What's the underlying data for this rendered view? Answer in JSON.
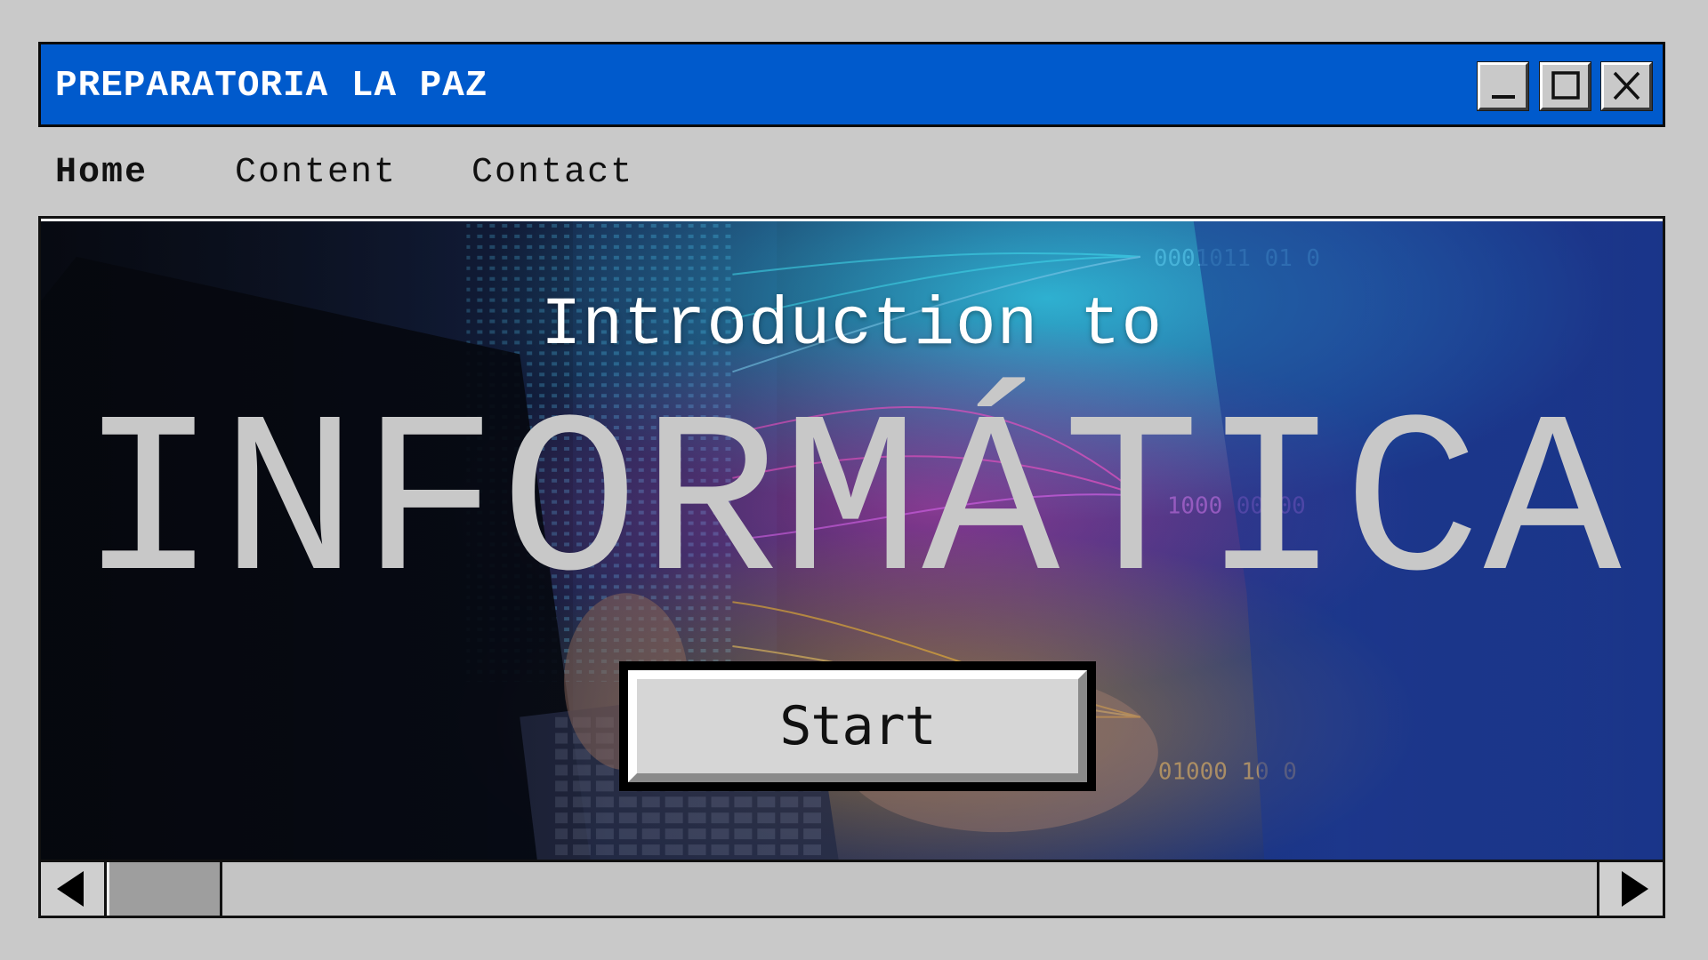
{
  "window": {
    "title": "PREPARATORIA LA PAZ",
    "controls": {
      "minimize": "minimize-icon",
      "maximize": "maximize-icon",
      "close": "close-icon"
    },
    "accent_color": "#005acc"
  },
  "menu": {
    "items": [
      {
        "label": "Home",
        "active": true
      },
      {
        "label": "Content",
        "active": false
      },
      {
        "label": "Contact",
        "active": false
      }
    ]
  },
  "hero": {
    "intro": "Introduction to",
    "title": "INFORMÁTICA",
    "background": "laptop-data-visualization-image"
  },
  "start_button": {
    "label": "Start"
  },
  "scrollbar": {
    "left_arrow": "left-arrow-icon",
    "right_arrow": "right-arrow-icon",
    "position": 0.0
  }
}
